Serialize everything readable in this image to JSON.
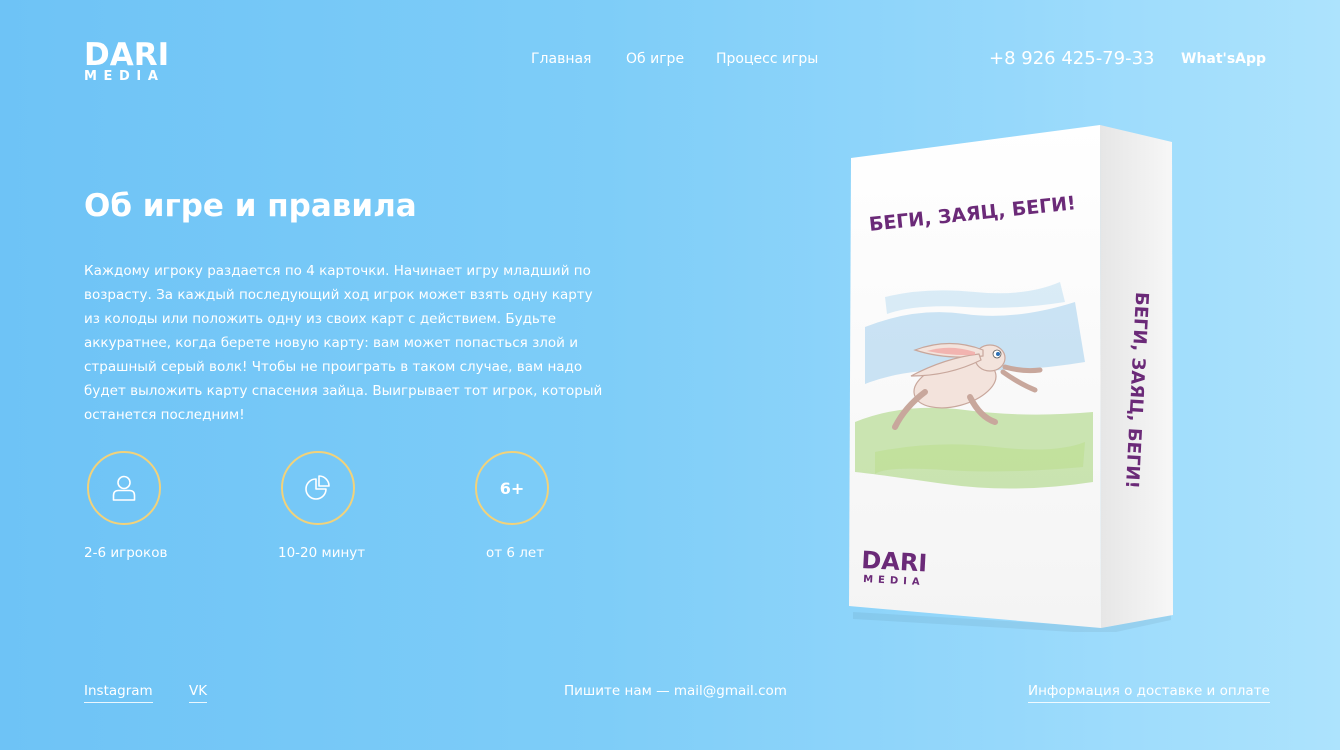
{
  "logo": {
    "line1": "DARI",
    "line2": "MEDIA"
  },
  "nav": {
    "items": [
      "Главная",
      "Об игре",
      "Процесс игры"
    ]
  },
  "contact": {
    "phone": "+8 926 425-79-33",
    "whatsapp": "What'sApp"
  },
  "main": {
    "title": "Об игре и правила",
    "description": "Каждому игроку раздается по 4 карточки. Начинает игру младший по возрасту. За каждый последующий ход игрок может взять одну карту из колоды или положить одну из своих карт с действием. Будьте аккуратнее, когда берете новую карту: вам может попасться злой и страшный серый волк! Чтобы не проиграть в таком случае, вам надо будет выложить карту спасения зайца. Выигрывает тот игрок, который останется последним!",
    "features": [
      {
        "icon": "user-icon",
        "label": "2-6 игроков"
      },
      {
        "icon": "pie-chart-icon",
        "label": "10-20 минут"
      },
      {
        "icon": "age-badge",
        "badge": "6+",
        "label": "от 6 лет"
      }
    ]
  },
  "product": {
    "front_title": "БЕГИ, ЗАЯЦ, БЕГИ!",
    "side_title": "БЕГИ, ЗАЯЦ, БЕГИ!",
    "brand_line1": "DARI",
    "brand_line2": "MEDIA"
  },
  "footer": {
    "social": [
      "Instagram",
      "VK"
    ],
    "mail_text": "Пишите нам — mail@gmail.com",
    "delivery_link": "Информация о доставке и оплате"
  },
  "colors": {
    "accent_circle": "#f2d27a",
    "brand_purple": "#6b2a78",
    "background_start": "#6ec3f6",
    "background_end": "#ade3fd"
  }
}
